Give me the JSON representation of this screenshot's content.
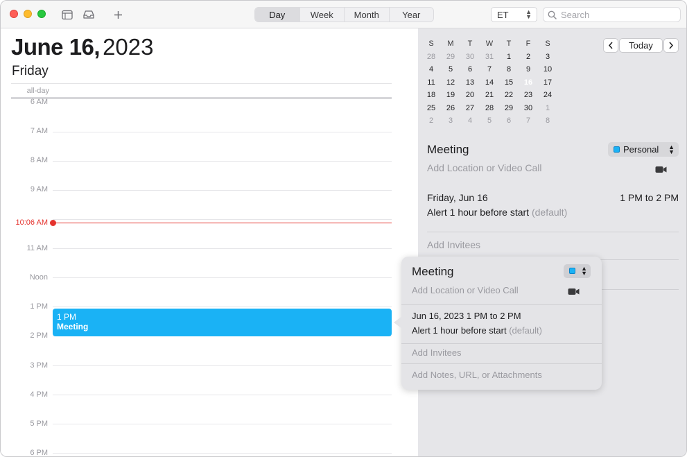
{
  "toolbar": {
    "views": [
      "Day",
      "Week",
      "Month",
      "Year"
    ],
    "active_view": "Day",
    "timezone": "ET",
    "search_placeholder": "Search"
  },
  "day": {
    "month_day": "June 16,",
    "year": "2023",
    "weekday": "Friday",
    "allday_label": "all-day",
    "hours": [
      "6 AM",
      "7 AM",
      "8 AM",
      "9 AM",
      "11 AM",
      "Noon",
      "1 PM",
      "2 PM",
      "3 PM",
      "4 PM",
      "5 PM",
      "6 PM"
    ],
    "now_label": "10:06 AM",
    "event": {
      "time": "1 PM",
      "title": "Meeting",
      "color": "#1ab2f5"
    }
  },
  "mini_calendar": {
    "weekdays": [
      "S",
      "M",
      "T",
      "W",
      "T",
      "F",
      "S"
    ],
    "weeks": [
      [
        "28",
        "29",
        "30",
        "31",
        "1",
        "2",
        "3"
      ],
      [
        "4",
        "5",
        "6",
        "7",
        "8",
        "9",
        "10"
      ],
      [
        "11",
        "12",
        "13",
        "14",
        "15",
        "16",
        "17"
      ],
      [
        "18",
        "19",
        "20",
        "21",
        "22",
        "23",
        "24"
      ],
      [
        "25",
        "26",
        "27",
        "28",
        "29",
        "30",
        "1"
      ],
      [
        "2",
        "3",
        "4",
        "5",
        "6",
        "7",
        "8"
      ]
    ],
    "today": "16",
    "today_label": "Today",
    "today_color": "#e5322d"
  },
  "inspector": {
    "title": "Meeting",
    "calendar": "Personal",
    "location_placeholder": "Add Location or Video Call",
    "date": "Friday, Jun 16",
    "time": "1 PM to 2 PM",
    "alert": "Alert 1 hour before start",
    "alert_default": "(default)",
    "invitees": "Add Invitees"
  },
  "popover": {
    "title": "Meeting",
    "location_placeholder": "Add Location or Video Call",
    "datetime": "Jun 16, 2023  1 PM to 2 PM",
    "alert": "Alert 1 hour before start",
    "alert_default": "(default)",
    "invitees": "Add Invitees",
    "notes": "Add Notes, URL, or Attachments"
  }
}
